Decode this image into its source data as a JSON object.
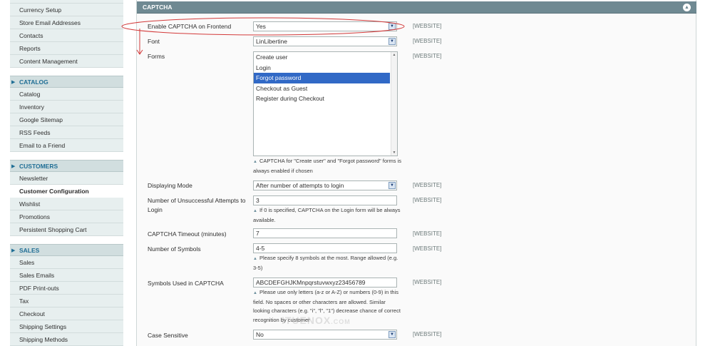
{
  "sidebar": {
    "top_items": [
      "Currency Setup",
      "Store Email Addresses",
      "Contacts",
      "Reports",
      "Content Management"
    ],
    "catalog": {
      "title": "CATALOG",
      "items": [
        "Catalog",
        "Inventory",
        "Google Sitemap",
        "RSS Feeds",
        "Email to a Friend"
      ]
    },
    "customers": {
      "title": "CUSTOMERS",
      "items": [
        "Newsletter",
        "Customer Configuration",
        "Wishlist",
        "Promotions",
        "Persistent Shopping Cart"
      ]
    },
    "sales": {
      "title": "SALES",
      "items": [
        "Sales",
        "Sales Emails",
        "PDF Print-outs",
        "Tax",
        "Checkout",
        "Shipping Settings",
        "Shipping Methods"
      ]
    }
  },
  "panel": {
    "title": "CAPTCHA",
    "collapse_glyph": "▲"
  },
  "scope_label": "[WEBSITE]",
  "fields": {
    "enable": {
      "label": "Enable CAPTCHA on Frontend",
      "value": "Yes"
    },
    "font": {
      "label": "Font",
      "value": "LinLibertine"
    },
    "forms": {
      "label": "Forms",
      "options": [
        "Create user",
        "Login",
        "Forgot password",
        "Checkout as Guest",
        "Register during Checkout"
      ],
      "selected_index": 2,
      "note": "CAPTCHA for \"Create user\" and \"Forgot password\" forms is always enabled if chosen"
    },
    "mode": {
      "label": "Displaying Mode",
      "value": "After number of attempts to login"
    },
    "attempts": {
      "label": "Number of Unsuccessful Attempts to Login",
      "value": "3",
      "note": "If 0 is specified, CAPTCHA on the Login form will be always available."
    },
    "timeout": {
      "label": "CAPTCHA Timeout (minutes)",
      "value": "7"
    },
    "symbols": {
      "label": "Number of Symbols",
      "value": "4-5",
      "note": "Please specify 8 symbols at the most. Range allowed (e.g. 3-5)"
    },
    "used": {
      "label": "Symbols Used in CAPTCHA",
      "value": "ABCDEFGHJKMnpqrstuvwxyz23456789",
      "note": "Please use only letters (a-z or A-Z) or numbers (0-9) in this field. No spaces or other characters are allowed. Similar looking characters (e.g. \"i\", \"l\", \"1\") decrease chance of correct recognition by customer"
    },
    "case": {
      "label": "Case Sensitive",
      "value": "No"
    }
  },
  "watermark": {
    "main": "ITUENOX",
    "suffix": ".COM"
  },
  "colors": {
    "accent": "#1f6e95",
    "selection": "#3169c6",
    "annotation": "#d33a3a",
    "header": "#6f8992"
  }
}
